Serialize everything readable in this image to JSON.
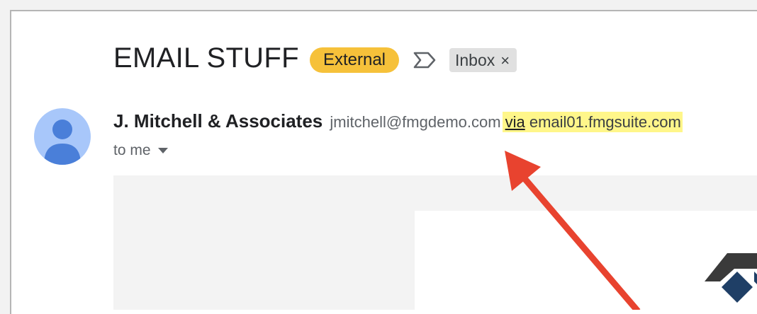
{
  "subject": "EMAIL STUFF",
  "labels": {
    "external": "External",
    "inbox": "Inbox",
    "inbox_remove": "×"
  },
  "sender": {
    "name": "J. Mitchell & Associates",
    "email": "jmitchell@fmgdemo.com",
    "via_word": "via",
    "via_domain": "email01.fmgsuite.com"
  },
  "recipient": {
    "text": "to me"
  },
  "colors": {
    "external_label": "#f6c13a",
    "via_highlight": "#fff68a",
    "arrow": "#e8432f",
    "avatar": "#a8c7fa",
    "avatar_figure": "#4a7fd9"
  },
  "icons": {
    "important": "important-marker-icon",
    "avatar": "person-avatar-icon",
    "expand": "chevron-down-icon"
  }
}
